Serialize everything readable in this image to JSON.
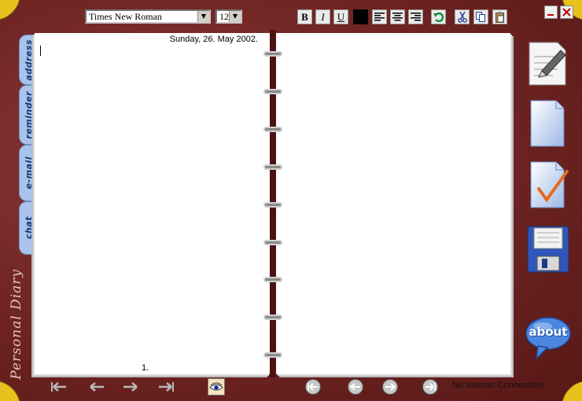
{
  "toolbar": {
    "font_family": "Times New Roman",
    "font_size": "12",
    "bold_label": "B",
    "italic_label": "I",
    "underline_label": "U",
    "text_color": "#000000"
  },
  "tabs": [
    {
      "id": "address",
      "label": "address"
    },
    {
      "id": "reminder",
      "label": "reminder"
    },
    {
      "id": "email",
      "label": "e-mail"
    },
    {
      "id": "chat",
      "label": "chat"
    }
  ],
  "brand": "Personal Diary",
  "page": {
    "date": "Sunday, 26. May 2002.",
    "number": "1."
  },
  "right_actions": [
    {
      "id": "write",
      "icon": "write-note-icon"
    },
    {
      "id": "new",
      "icon": "new-page-icon"
    },
    {
      "id": "check",
      "icon": "checked-page-icon"
    },
    {
      "id": "save",
      "icon": "floppy-disk-icon"
    }
  ],
  "about_label": "about",
  "status": "No Internet Connection!",
  "colors": {
    "leather": "#6e2422",
    "corner": "#e7c21c",
    "tab": "#a9c4ec",
    "tab_text": "#15357a"
  }
}
